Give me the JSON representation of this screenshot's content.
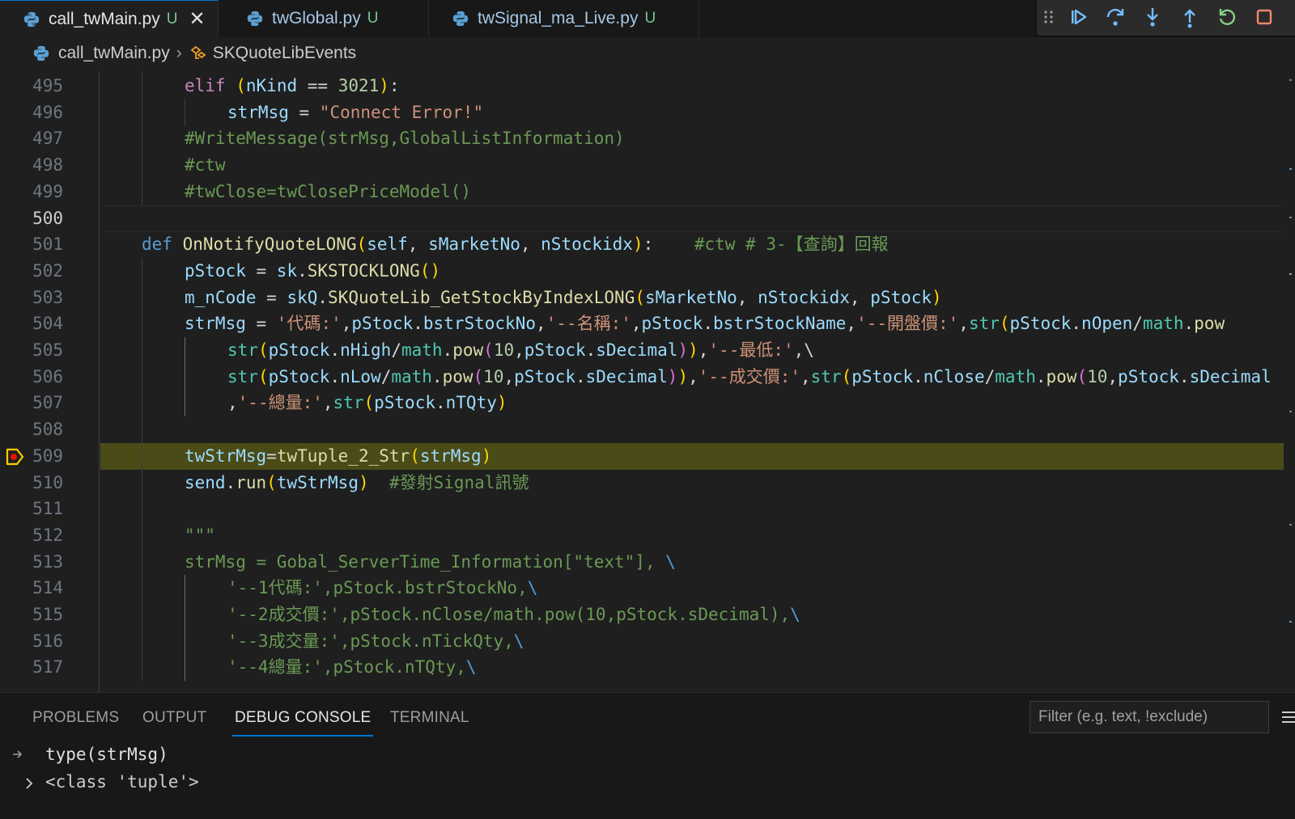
{
  "tabs": [
    {
      "label": "call_twMain.py",
      "status": "U",
      "active": true
    },
    {
      "label": "twGlobal.py",
      "status": "U",
      "active": false
    },
    {
      "label": "twSignal_ma_Live.py",
      "status": "U",
      "active": false
    }
  ],
  "tab_close_glyph": "✕",
  "debug_toolbar": [
    "drag-handle",
    "continue",
    "step-over",
    "step-into",
    "step-out",
    "restart",
    "stop"
  ],
  "breadcrumb": {
    "file": "call_twMain.py",
    "symbol": "SKQuoteLibEvents"
  },
  "editor": {
    "current_line": 500,
    "breakpoint_line": 509,
    "lines": [
      {
        "n": "495",
        "indent": 2,
        "tokens": [
          [
            "kw",
            "elif"
          ],
          [
            "op",
            " "
          ],
          [
            "p1",
            "("
          ],
          [
            "var",
            "nKind"
          ],
          [
            "op",
            " == "
          ],
          [
            "num",
            "3021"
          ],
          [
            "p1",
            ")"
          ],
          [
            "op",
            ":"
          ]
        ]
      },
      {
        "n": "496",
        "indent": 3,
        "tokens": [
          [
            "var",
            "strMsg"
          ],
          [
            "op",
            " = "
          ],
          [
            "str",
            "\"Connect Error!\""
          ]
        ]
      },
      {
        "n": "497",
        "indent": 2,
        "tokens": [
          [
            "com",
            "#WriteMessage(strMsg,GlobalListInformation)"
          ]
        ]
      },
      {
        "n": "498",
        "indent": 2,
        "tokens": [
          [
            "com",
            "#ctw"
          ]
        ]
      },
      {
        "n": "499",
        "indent": 2,
        "tokens": [
          [
            "com",
            "#twClose=twClosePriceModel()"
          ]
        ]
      },
      {
        "n": "500",
        "indent": 0,
        "tokens": []
      },
      {
        "n": "501",
        "indent": 1,
        "tokens": [
          [
            "kw2",
            "def"
          ],
          [
            "op",
            " "
          ],
          [
            "fn",
            "OnNotifyQuoteLONG"
          ],
          [
            "p1",
            "("
          ],
          [
            "var",
            "self"
          ],
          [
            "op",
            ", "
          ],
          [
            "var",
            "sMarketNo"
          ],
          [
            "op",
            ", "
          ],
          [
            "var",
            "nStockidx"
          ],
          [
            "p1",
            ")"
          ],
          [
            "op",
            ":    "
          ],
          [
            "com",
            "#ctw # 3-【查詢】回報"
          ]
        ]
      },
      {
        "n": "502",
        "indent": 2,
        "tokens": [
          [
            "var",
            "pStock"
          ],
          [
            "op",
            " = "
          ],
          [
            "var",
            "sk"
          ],
          [
            "op",
            "."
          ],
          [
            "fn",
            "SKSTOCKLONG"
          ],
          [
            "p1",
            "()"
          ]
        ]
      },
      {
        "n": "503",
        "indent": 2,
        "tokens": [
          [
            "var",
            "m_nCode"
          ],
          [
            "op",
            " = "
          ],
          [
            "var",
            "skQ"
          ],
          [
            "op",
            "."
          ],
          [
            "fn",
            "SKQuoteLib_GetStockByIndexLONG"
          ],
          [
            "p1",
            "("
          ],
          [
            "var",
            "sMarketNo"
          ],
          [
            "op",
            ", "
          ],
          [
            "var",
            "nStockidx"
          ],
          [
            "op",
            ", "
          ],
          [
            "var",
            "pStock"
          ],
          [
            "p1",
            ")"
          ]
        ]
      },
      {
        "n": "504",
        "indent": 2,
        "tokens": [
          [
            "var",
            "strMsg"
          ],
          [
            "op",
            " = "
          ],
          [
            "str",
            "'代碼:'"
          ],
          [
            "op",
            ","
          ],
          [
            "var",
            "pStock"
          ],
          [
            "op",
            "."
          ],
          [
            "var",
            "bstrStockNo"
          ],
          [
            "op",
            ","
          ],
          [
            "str",
            "'--名稱:'"
          ],
          [
            "op",
            ","
          ],
          [
            "var",
            "pStock"
          ],
          [
            "op",
            "."
          ],
          [
            "var",
            "bstrStockName"
          ],
          [
            "op",
            ","
          ],
          [
            "str",
            "'--開盤價:'"
          ],
          [
            "op",
            ","
          ],
          [
            "cls",
            "str"
          ],
          [
            "p1",
            "("
          ],
          [
            "var",
            "pStock"
          ],
          [
            "op",
            "."
          ],
          [
            "var",
            "nOpen"
          ],
          [
            "op",
            "/"
          ],
          [
            "cls",
            "math"
          ],
          [
            "op",
            "."
          ],
          [
            "fn",
            "pow"
          ]
        ]
      },
      {
        "n": "505",
        "indent": 3,
        "tokens": [
          [
            "cls",
            "str"
          ],
          [
            "p1",
            "("
          ],
          [
            "var",
            "pStock"
          ],
          [
            "op",
            "."
          ],
          [
            "var",
            "nHigh"
          ],
          [
            "op",
            "/"
          ],
          [
            "cls",
            "math"
          ],
          [
            "op",
            "."
          ],
          [
            "fn",
            "pow"
          ],
          [
            "p2",
            "("
          ],
          [
            "num",
            "10"
          ],
          [
            "op",
            ","
          ],
          [
            "var",
            "pStock"
          ],
          [
            "op",
            "."
          ],
          [
            "var",
            "sDecimal"
          ],
          [
            "p2",
            ")"
          ],
          [
            "p1",
            ")"
          ],
          [
            "op",
            ","
          ],
          [
            "str",
            "'--最低:'"
          ],
          [
            "op",
            ",\\"
          ]
        ]
      },
      {
        "n": "506",
        "indent": 3,
        "tokens": [
          [
            "cls",
            "str"
          ],
          [
            "p1",
            "("
          ],
          [
            "var",
            "pStock"
          ],
          [
            "op",
            "."
          ],
          [
            "var",
            "nLow"
          ],
          [
            "op",
            "/"
          ],
          [
            "cls",
            "math"
          ],
          [
            "op",
            "."
          ],
          [
            "fn",
            "pow"
          ],
          [
            "p2",
            "("
          ],
          [
            "num",
            "10"
          ],
          [
            "op",
            ","
          ],
          [
            "var",
            "pStock"
          ],
          [
            "op",
            "."
          ],
          [
            "var",
            "sDecimal"
          ],
          [
            "p2",
            ")"
          ],
          [
            "p1",
            ")"
          ],
          [
            "op",
            ","
          ],
          [
            "str",
            "'--成交價:'"
          ],
          [
            "op",
            ","
          ],
          [
            "cls",
            "str"
          ],
          [
            "p1",
            "("
          ],
          [
            "var",
            "pStock"
          ],
          [
            "op",
            "."
          ],
          [
            "var",
            "nClose"
          ],
          [
            "op",
            "/"
          ],
          [
            "cls",
            "math"
          ],
          [
            "op",
            "."
          ],
          [
            "fn",
            "pow"
          ],
          [
            "p2",
            "("
          ],
          [
            "num",
            "10"
          ],
          [
            "op",
            ","
          ],
          [
            "var",
            "pStock"
          ],
          [
            "op",
            "."
          ],
          [
            "var",
            "sDecimal"
          ]
        ]
      },
      {
        "n": "507",
        "indent": 3,
        "tokens": [
          [
            "op",
            ","
          ],
          [
            "str",
            "'--總量:'"
          ],
          [
            "op",
            ","
          ],
          [
            "cls",
            "str"
          ],
          [
            "p1",
            "("
          ],
          [
            "var",
            "pStock"
          ],
          [
            "op",
            "."
          ],
          [
            "var",
            "nTQty"
          ],
          [
            "p1",
            ")"
          ]
        ]
      },
      {
        "n": "508",
        "indent": 2,
        "tokens": []
      },
      {
        "n": "509",
        "indent": 2,
        "tokens": [
          [
            "var",
            "twStrMsg"
          ],
          [
            "op",
            "="
          ],
          [
            "fn",
            "twTuple_2_Str"
          ],
          [
            "p1",
            "("
          ],
          [
            "var",
            "strMsg"
          ],
          [
            "p1",
            ")"
          ]
        ]
      },
      {
        "n": "510",
        "indent": 2,
        "tokens": [
          [
            "var",
            "send"
          ],
          [
            "op",
            "."
          ],
          [
            "fn",
            "run"
          ],
          [
            "p1",
            "("
          ],
          [
            "var",
            "twStrMsg"
          ],
          [
            "p1",
            ")"
          ],
          [
            "op",
            "  "
          ],
          [
            "com",
            "#發射Signal訊號"
          ]
        ]
      },
      {
        "n": "511",
        "indent": 2,
        "tokens": []
      },
      {
        "n": "512",
        "indent": 2,
        "tokens": [
          [
            "com",
            "\"\"\""
          ]
        ]
      },
      {
        "n": "513",
        "indent": 2,
        "tokens": [
          [
            "com",
            "strMsg = Gobal_ServerTime_Information[\"text\"], "
          ],
          [
            "kw2",
            "\\"
          ]
        ]
      },
      {
        "n": "514",
        "indent": 3,
        "tokens": [
          [
            "com",
            "'--1代碼:',pStock.bstrStockNo,"
          ],
          [
            "kw2",
            "\\"
          ]
        ]
      },
      {
        "n": "515",
        "indent": 3,
        "tokens": [
          [
            "com",
            "'--2成交價:',pStock.nClose/math.pow(10,pStock.sDecimal),"
          ],
          [
            "kw2",
            "\\"
          ]
        ]
      },
      {
        "n": "516",
        "indent": 3,
        "tokens": [
          [
            "com",
            "'--3成交量:',pStock.nTickQty,"
          ],
          [
            "kw2",
            "\\"
          ]
        ]
      },
      {
        "n": "517",
        "indent": 3,
        "tokens": [
          [
            "com",
            "'--4總量:',pStock.nTQty,"
          ],
          [
            "kw2",
            "\\"
          ]
        ]
      }
    ]
  },
  "panel": {
    "tabs": [
      "PROBLEMS",
      "OUTPUT",
      "DEBUG CONSOLE",
      "TERMINAL"
    ],
    "active_tab": "DEBUG CONSOLE",
    "filter_placeholder": "Filter (e.g. text, !exclude)",
    "console": {
      "input": "type(strMsg)",
      "output": "<class 'tuple'>"
    }
  }
}
